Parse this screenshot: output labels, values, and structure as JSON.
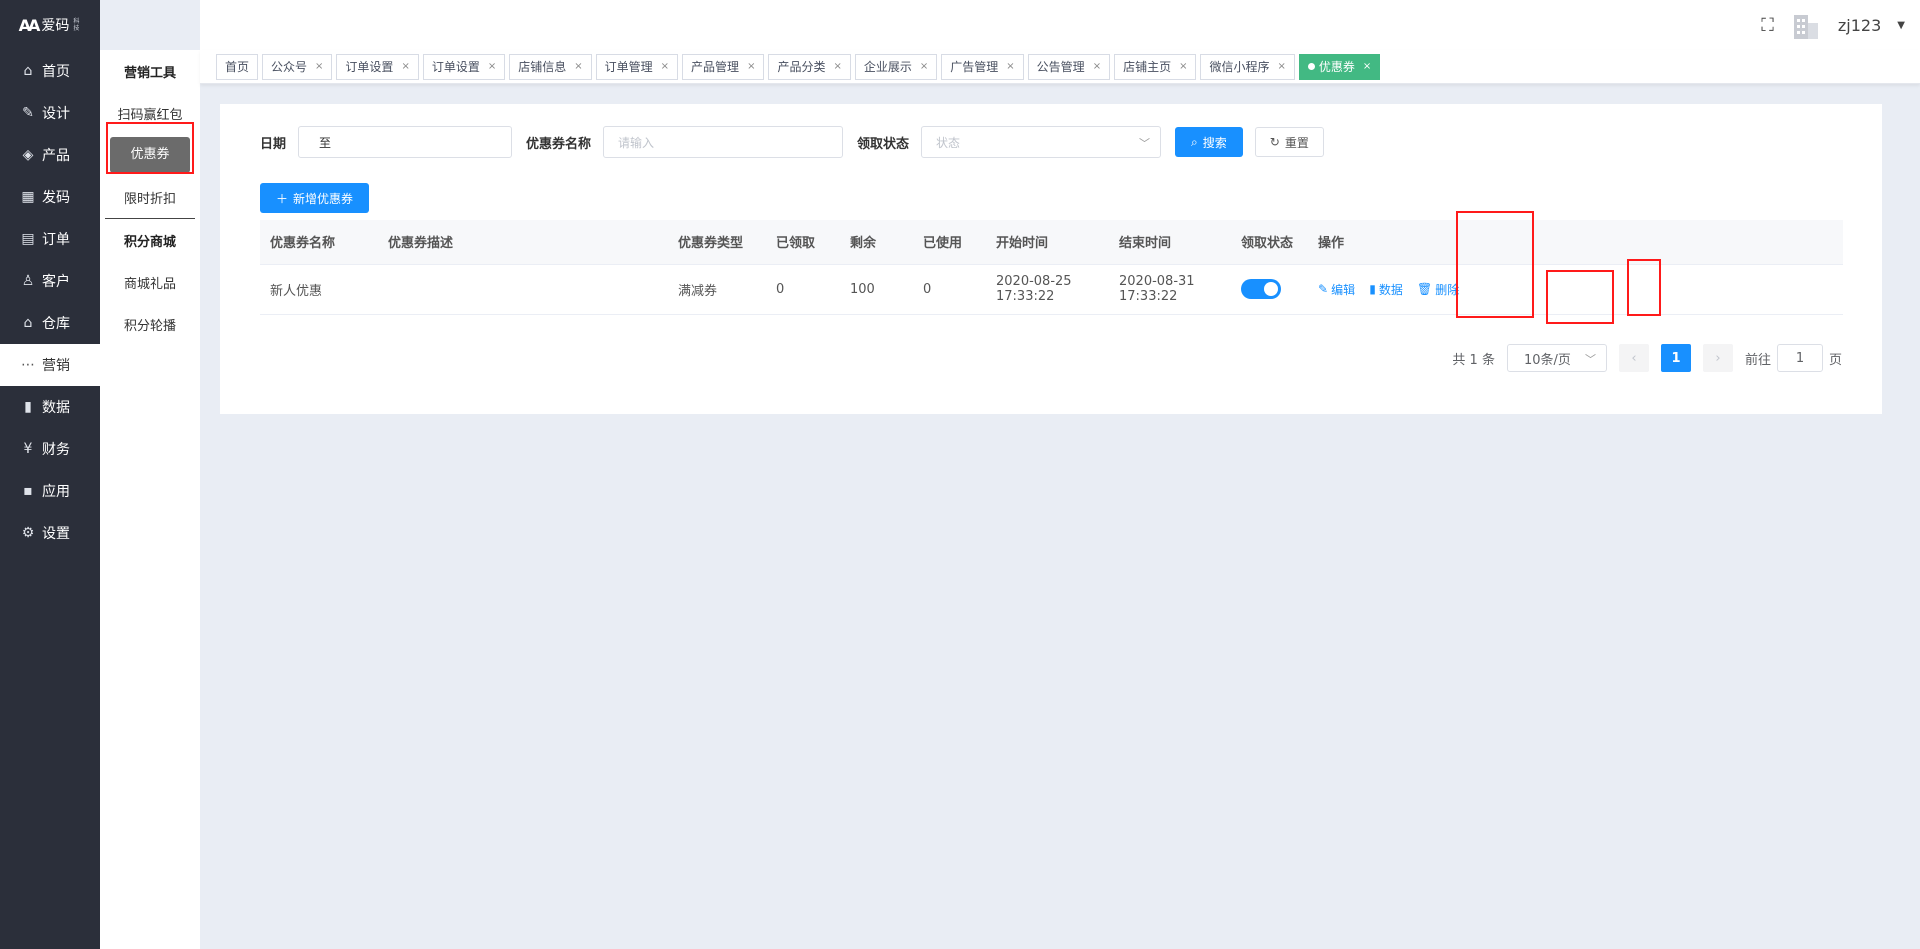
{
  "logo": {
    "mark": "AA",
    "text": "爱码",
    "sub": "科技"
  },
  "nav": [
    {
      "label": "首页",
      "icon": "home-icon",
      "glyph": "⌂"
    },
    {
      "label": "设计",
      "icon": "design-icon",
      "glyph": "✎"
    },
    {
      "label": "产品",
      "icon": "box-icon",
      "glyph": "◈"
    },
    {
      "label": "发码",
      "icon": "qrcode-icon",
      "glyph": "▦"
    },
    {
      "label": "订单",
      "icon": "order-icon",
      "glyph": "▤"
    },
    {
      "label": "客户",
      "icon": "user-icon",
      "glyph": "♙"
    },
    {
      "label": "仓库",
      "icon": "warehouse-icon",
      "glyph": "⌂"
    },
    {
      "label": "营销",
      "icon": "share-icon",
      "glyph": "⋯"
    },
    {
      "label": "数据",
      "icon": "chart-icon",
      "glyph": "▮"
    },
    {
      "label": "财务",
      "icon": "yen-icon",
      "glyph": "¥"
    },
    {
      "label": "应用",
      "icon": "apps-icon",
      "glyph": "▪"
    },
    {
      "label": "设置",
      "icon": "gear-icon",
      "glyph": "⚙"
    }
  ],
  "subnav": {
    "group1": "营销工具",
    "items1": [
      "扫码赢红包",
      "优惠券",
      "限时折扣"
    ],
    "group2": "积分商城",
    "items2": [
      "商城礼品",
      "积分轮播"
    ]
  },
  "header": {
    "username": "zj123"
  },
  "tabs": [
    "首页",
    "公众号",
    "订单设置",
    "订单设置",
    "店铺信息",
    "订单管理",
    "产品管理",
    "产品分类",
    "企业展示",
    "广告管理",
    "公告管理",
    "店铺主页",
    "微信小程序",
    "优惠券"
  ],
  "filter": {
    "date_label": "日期",
    "date_sep": "至",
    "name_label": "优惠券名称",
    "name_placeholder": "请输入",
    "status_label": "领取状态",
    "status_placeholder": "状态",
    "search_btn": "搜索",
    "reset_btn": "重置"
  },
  "add_btn": "新增优惠券",
  "table": {
    "columns": [
      "优惠券名称",
      "优惠券描述",
      "优惠券类型",
      "已领取",
      "剩余",
      "已使用",
      "开始时间",
      "结束时间",
      "领取状态",
      "操作"
    ],
    "rows": [
      {
        "name": "新人优惠",
        "desc": "",
        "type": "满减券",
        "received": "0",
        "remaining": "100",
        "used": "0",
        "start": "2020-08-25 17:33:22",
        "end": "2020-08-31 17:33:22",
        "enabled": true
      }
    ],
    "actions": {
      "edit": "编辑",
      "data": "数据",
      "delete": "删除"
    }
  },
  "pagination": {
    "total": "共 1 条",
    "page_size": "10条/页",
    "current": "1",
    "goto_prefix": "前往",
    "goto_value": "1",
    "goto_suffix": "页"
  },
  "colors": {
    "primary": "#1890ff",
    "tab_active": "#42b983",
    "sidebar": "#2b2f3a",
    "highlight": "#ff1a1a"
  }
}
